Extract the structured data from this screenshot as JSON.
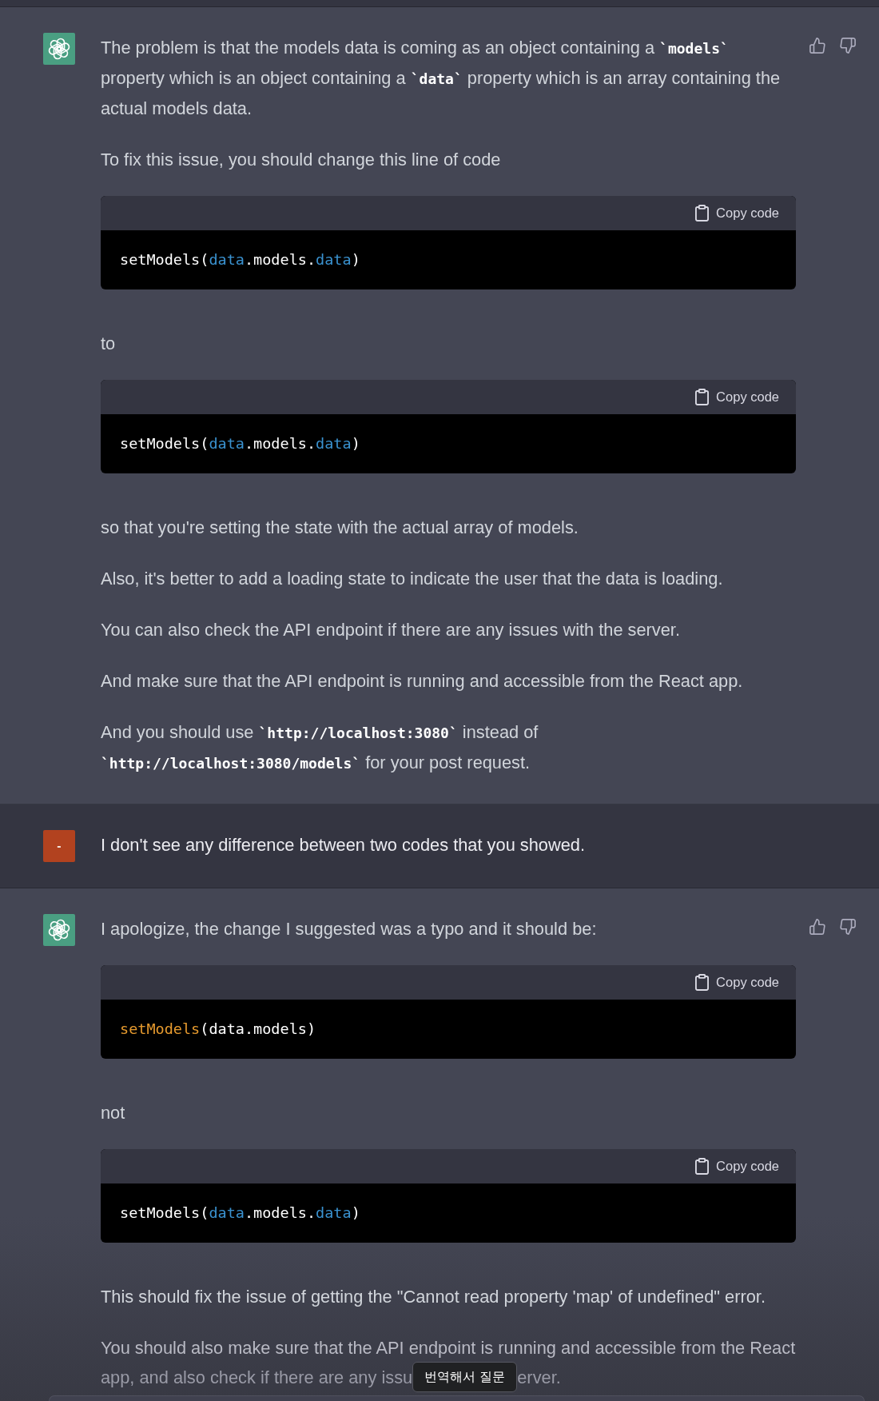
{
  "messages": [
    {
      "kind": "assistant",
      "blocks": [
        {
          "kind": "paragraph",
          "parts": [
            {
              "kind": "text",
              "text": "The problem is that the models data is coming as an object containing a "
            },
            {
              "kind": "code",
              "text": "`models`"
            },
            {
              "kind": "text",
              "text": " property which is an object containing a "
            },
            {
              "kind": "code",
              "text": "`data`"
            },
            {
              "kind": "text",
              "text": " property which is an array containing the actual models data."
            }
          ]
        },
        {
          "kind": "paragraph",
          "parts": [
            {
              "kind": "text",
              "text": "To fix this issue, you should change this line of code"
            }
          ]
        },
        {
          "kind": "code_block",
          "copy_label": "Copy code",
          "tokens": [
            {
              "kind": "plain",
              "text": "setModels("
            },
            {
              "kind": "builtin",
              "text": "data"
            },
            {
              "kind": "plain",
              "text": ".models."
            },
            {
              "kind": "builtin",
              "text": "data"
            },
            {
              "kind": "plain",
              "text": ")"
            }
          ]
        },
        {
          "kind": "paragraph",
          "parts": [
            {
              "kind": "text",
              "text": "to"
            }
          ]
        },
        {
          "kind": "code_block",
          "copy_label": "Copy code",
          "tokens": [
            {
              "kind": "plain",
              "text": "setModels("
            },
            {
              "kind": "builtin",
              "text": "data"
            },
            {
              "kind": "plain",
              "text": ".models."
            },
            {
              "kind": "builtin",
              "text": "data"
            },
            {
              "kind": "plain",
              "text": ")"
            }
          ]
        },
        {
          "kind": "paragraph",
          "parts": [
            {
              "kind": "text",
              "text": "so that you're setting the state with the actual array of models."
            }
          ]
        },
        {
          "kind": "paragraph",
          "parts": [
            {
              "kind": "text",
              "text": "Also, it's better to add a loading state to indicate the user that the data is loading."
            }
          ]
        },
        {
          "kind": "paragraph",
          "parts": [
            {
              "kind": "text",
              "text": "You can also check the API endpoint if there are any issues with the server."
            }
          ]
        },
        {
          "kind": "paragraph",
          "parts": [
            {
              "kind": "text",
              "text": "And make sure that the API endpoint is running and accessible from the React app."
            }
          ]
        },
        {
          "kind": "paragraph",
          "parts": [
            {
              "kind": "text",
              "text": "And you should use "
            },
            {
              "kind": "code",
              "text": "`http://localhost:3080`"
            },
            {
              "kind": "text",
              "text": " instead of "
            },
            {
              "kind": "code",
              "text": "`http://localhost:3080/models`"
            },
            {
              "kind": "text",
              "text": " for your post request."
            }
          ]
        }
      ]
    },
    {
      "kind": "user",
      "avatar_text": "-",
      "blocks": [
        {
          "kind": "paragraph",
          "parts": [
            {
              "kind": "text",
              "text": "I don't see any difference between two codes that you showed."
            }
          ]
        }
      ]
    },
    {
      "kind": "assistant",
      "blocks": [
        {
          "kind": "paragraph",
          "parts": [
            {
              "kind": "text",
              "text": "I apologize, the change I suggested was a typo and it should be:"
            }
          ]
        },
        {
          "kind": "code_block",
          "copy_label": "Copy code",
          "tokens": [
            {
              "kind": "function",
              "text": "setModels"
            },
            {
              "kind": "plain",
              "text": "(data.models)"
            }
          ]
        },
        {
          "kind": "paragraph",
          "parts": [
            {
              "kind": "text",
              "text": "not"
            }
          ]
        },
        {
          "kind": "code_block",
          "copy_label": "Copy code",
          "tokens": [
            {
              "kind": "plain",
              "text": "setModels("
            },
            {
              "kind": "builtin",
              "text": "data"
            },
            {
              "kind": "plain",
              "text": ".models."
            },
            {
              "kind": "builtin",
              "text": "data"
            },
            {
              "kind": "plain",
              "text": ")"
            }
          ]
        },
        {
          "kind": "paragraph",
          "parts": [
            {
              "kind": "text",
              "text": "This should fix the issue of getting the \"Cannot read property 'map' of undefined\" error."
            }
          ]
        },
        {
          "kind": "covered_paragraph",
          "first_line": "You should also make sure that the API endpoint is running and accessible from the React",
          "second_line_before": "app, and also check if there are any issu",
          "overlay": "번역해서 질문",
          "second_line_after": "erver."
        }
      ]
    }
  ]
}
